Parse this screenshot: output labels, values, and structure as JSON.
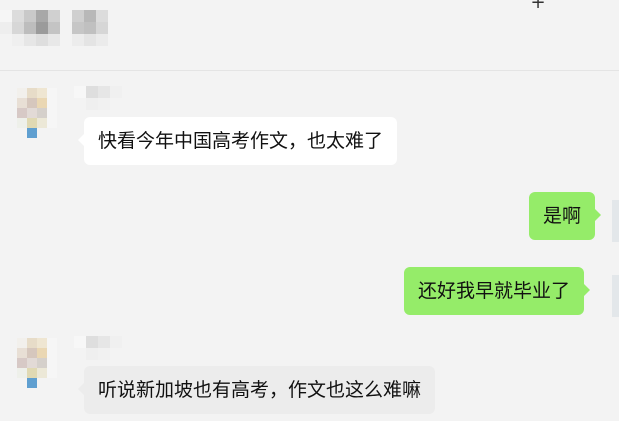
{
  "header": {
    "plus_icon": "+"
  },
  "messages": [
    {
      "side": "left",
      "text": "快看今年中国高考作文，也太难了"
    },
    {
      "side": "right",
      "text": "是啊"
    },
    {
      "side": "right",
      "text": "还好我早就毕业了"
    },
    {
      "side": "left",
      "text": "听说新加坡也有高考，作文也这么难嘛"
    }
  ],
  "colors": {
    "background": "#f3f3f3",
    "incoming_bubble": "#ffffff",
    "incoming_bubble_hover": "#ececec",
    "outgoing_bubble": "#95ec69"
  },
  "icons": {
    "more": "plus-icon"
  }
}
